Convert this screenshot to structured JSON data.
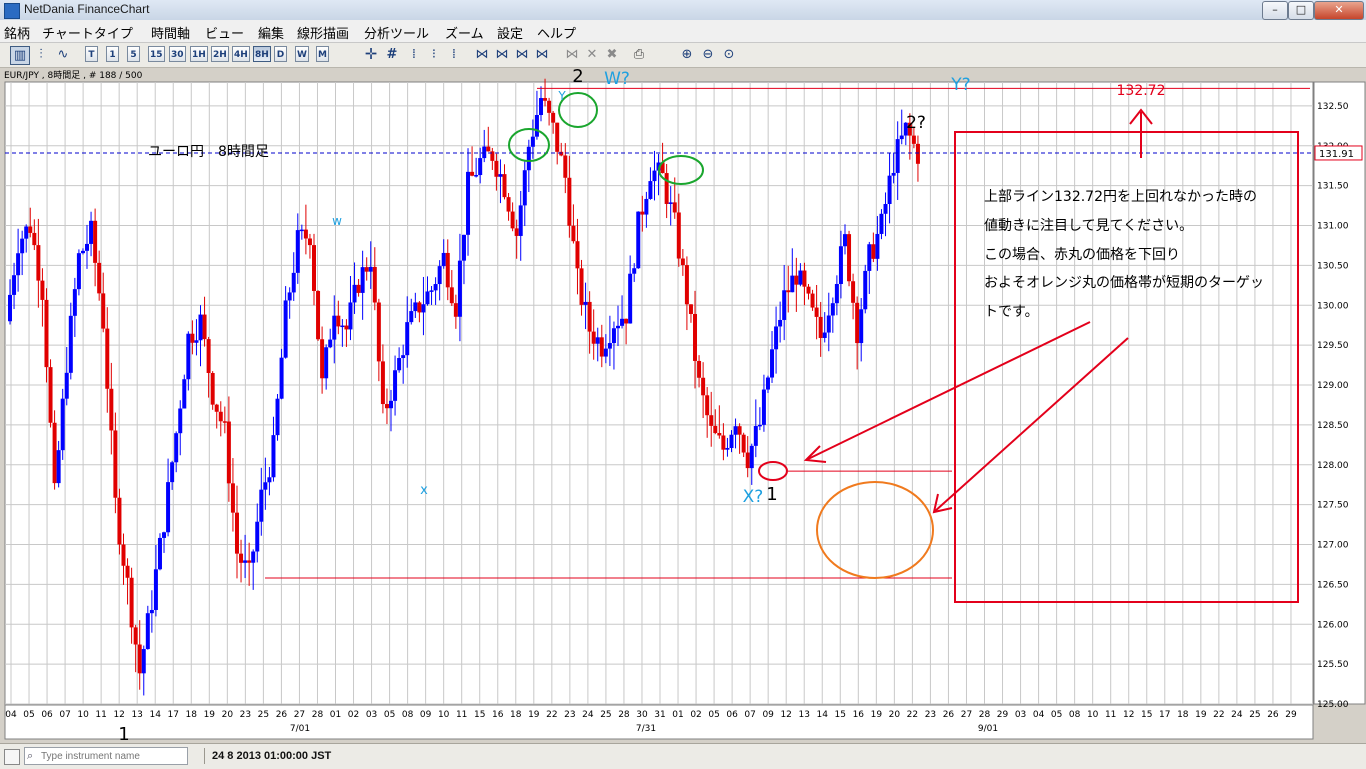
{
  "window": {
    "title": "NetDania FinanceChart",
    "btn_min": "–",
    "btn_max": "□",
    "btn_close": "✕"
  },
  "menu": [
    "銘柄",
    "チャートタイプ",
    "時間軸",
    "ビュー",
    "編集",
    "線形描画",
    "分析ツール",
    "ズーム",
    "設定",
    "ヘルプ"
  ],
  "toolbar": {
    "chart_type_icons": [
      "candlestick-chart-icon",
      "bar-chart-icon",
      "line-chart-icon"
    ],
    "intervals": [
      "T",
      "1",
      "5",
      "15",
      "30",
      "1H",
      "2H",
      "4H",
      "8H",
      "D",
      "W",
      "M"
    ],
    "selected_interval": "8H",
    "tool_icons": [
      "crosshair-icon",
      "grid-icon",
      "indicator-icon-1",
      "indicator-icon-2",
      "indicator-icon-3",
      "indicator-icon-4",
      "indicator-icon-5",
      "bar-style-icon-1",
      "bar-style-icon-2",
      "bar-style-icon-3",
      "bar-style-icon-4",
      "bar-style-icon-5",
      "bar-style-icon-6",
      "remove-study-icon",
      "delete-icon",
      "delete-all-icon",
      "print-icon",
      "zoom-in-icon",
      "zoom-out-icon",
      "zoom-reset-icon"
    ]
  },
  "chart": {
    "header": "EUR/JPY , 8時間足 , # 188 / 500",
    "title": "ユーロ円　8時間足",
    "current_price": "131.91",
    "price_labels": [
      "132.50",
      "132.00",
      "131.50",
      "131.00",
      "130.50",
      "130.00",
      "129.50",
      "129.00",
      "128.50",
      "128.00",
      "127.50",
      "127.00",
      "126.50",
      "126.00",
      "125.50",
      "125.00"
    ],
    "date_labels": [
      "04",
      "05",
      "06",
      "07",
      "10",
      "11",
      "12",
      "13",
      "14",
      "17",
      "18",
      "19",
      "20",
      "23",
      "25",
      "26",
      "27",
      "28",
      "01",
      "02",
      "03",
      "05",
      "08",
      "09",
      "10",
      "11",
      "15",
      "16",
      "18",
      "19",
      "22",
      "23",
      "24",
      "25",
      "28",
      "30",
      "31",
      "01",
      "02",
      "05",
      "06",
      "07",
      "09",
      "12",
      "13",
      "14",
      "15",
      "16",
      "19",
      "20",
      "22",
      "23",
      "26",
      "27",
      "28",
      "29",
      "03",
      "04",
      "05",
      "08",
      "10",
      "11",
      "12",
      "15",
      "17",
      "18",
      "19",
      "22",
      "24",
      "25",
      "26",
      "29"
    ],
    "month_labels": [
      "7/01",
      "7/31",
      "9/01"
    ],
    "colors": {
      "up": "#0000ff",
      "down": "#e00000",
      "grid": "#c8c8c8",
      "current_line": "#0000cc",
      "annotation_red": "#e3001b",
      "circle_green": "#1aa62e",
      "circle_orange": "#f07a1e",
      "wave_cyan": "#1ea0e0"
    },
    "annotations": {
      "wave_2_top": "2",
      "wave_w_q": "W?",
      "wave_y_small": "Y",
      "wave_y_q": "Y?",
      "wave_2_q": "2?",
      "wave_w": "w",
      "wave_x": "x",
      "wave_x_q": "X?",
      "wave_1": "1",
      "wave_1_low": "1",
      "target_label": "132.72",
      "note_line1": "上部ライン132.72円を上回れなかった時の",
      "note_line2": "値動きに注目して見てください。",
      "note_line3": "この場合、赤丸の価格を下回り",
      "note_line4": "およそオレンジ丸の価格帯が短期のターゲッ",
      "note_line5": "トです。"
    }
  },
  "chart_data": {
    "type": "candlestick",
    "symbol": "EUR/JPY",
    "interval": "8H",
    "ylim": [
      125.0,
      132.8
    ],
    "grid": true,
    "current_price": 131.91,
    "horizontal_lines": [
      132.72,
      131.91,
      127.92,
      126.58
    ],
    "path": [
      129.8,
      130.8,
      131.0,
      130.2,
      127.6,
      129.3,
      130.6,
      130.9,
      129.8,
      127.5,
      126.5,
      125.4,
      126.3,
      127.3,
      128.4,
      129.6,
      129.8,
      128.9,
      128.4,
      126.9,
      126.6,
      127.6,
      128.2,
      129.9,
      130.8,
      130.9,
      129.0,
      130.0,
      129.7,
      130.3,
      130.6,
      128.6,
      129.1,
      129.7,
      130.0,
      130.2,
      130.6,
      130.0,
      131.5,
      131.8,
      131.9,
      131.5,
      130.9,
      132.0,
      132.6,
      132.2,
      131.6,
      130.3,
      129.7,
      129.5,
      129.8,
      129.9,
      131.0,
      131.7,
      131.6,
      131.0,
      130.1,
      129.0,
      128.4,
      128.2,
      128.6,
      128.1,
      128.5,
      129.4,
      130.1,
      130.4,
      130.0,
      129.6,
      130.2,
      130.8,
      129.7,
      130.6,
      131.0,
      131.8,
      132.2,
      131.9
    ]
  }
}
